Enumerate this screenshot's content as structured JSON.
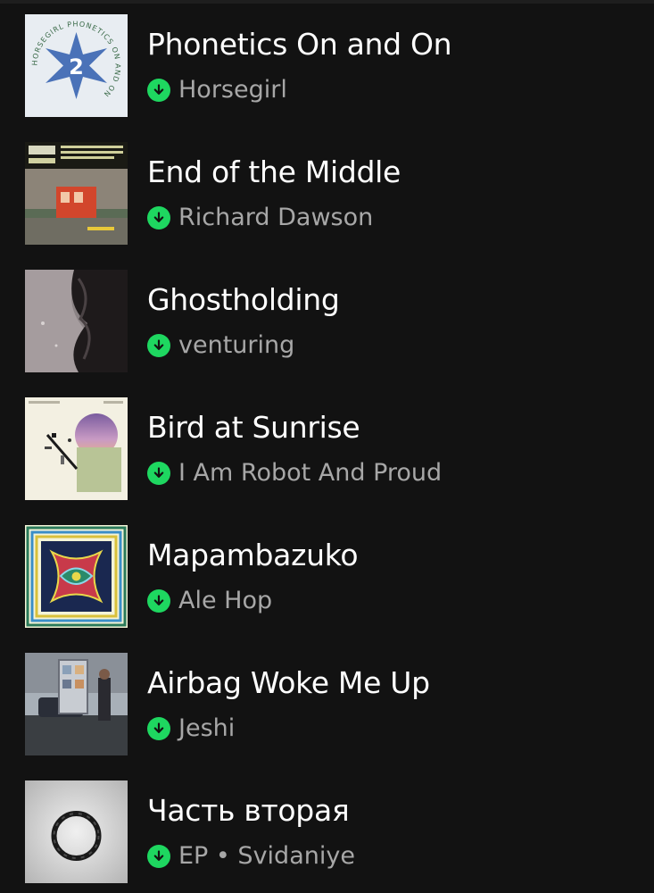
{
  "library": {
    "items": [
      {
        "title": "Phonetics On and On",
        "subtitle": "Horsegirl",
        "art_icon": "album-art-phonetics"
      },
      {
        "title": "End of the Middle",
        "subtitle": "Richard Dawson",
        "art_icon": "album-art-end-of-middle"
      },
      {
        "title": "Ghostholding",
        "subtitle": "venturing",
        "art_icon": "album-art-ghostholding"
      },
      {
        "title": "Bird at Sunrise",
        "subtitle": "I Am Robot And Proud",
        "art_icon": "album-art-bird-at-sunrise"
      },
      {
        "title": "Mapambazuko",
        "subtitle": "Ale Hop",
        "art_icon": "album-art-mapambazuko"
      },
      {
        "title": "Airbag Woke Me Up",
        "subtitle": "Jeshi",
        "art_icon": "album-art-airbag"
      },
      {
        "title": "Часть вторая",
        "subtitle": "EP • Svidaniye",
        "art_icon": "album-art-chast-vtoraya"
      }
    ],
    "art_text": {
      "phonetics_ring": "HORSEGIRL PHONETICS ON AND ON",
      "phonetics_number": "2"
    },
    "colors": {
      "background": "#121212",
      "download_green": "#1ed760",
      "title": "#ffffff",
      "subtitle": "#a7a7a7"
    },
    "download_icon": "download-arrow-icon"
  }
}
